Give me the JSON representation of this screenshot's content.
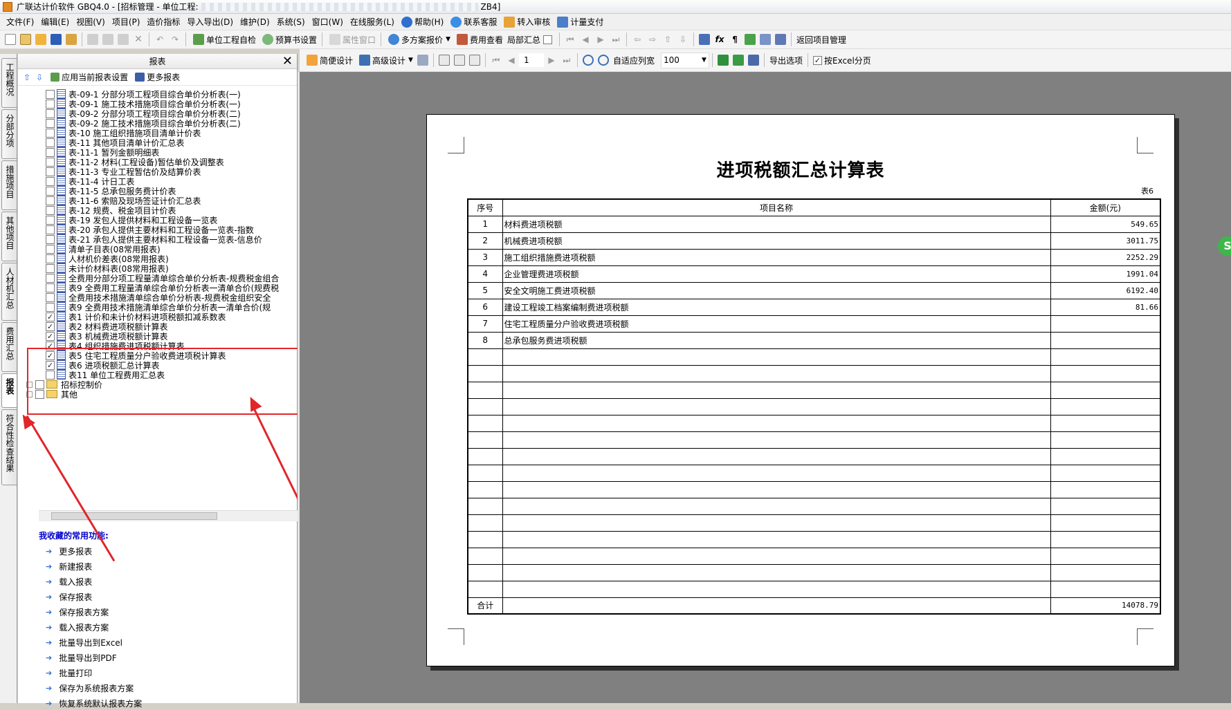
{
  "window": {
    "title_prefix": "广联达计价软件 GBQ4.0 - [招标管理 - 单位工程:",
    "title_suffix": "ZB4]"
  },
  "menu": [
    "文件(F)",
    "编辑(E)",
    "视图(V)",
    "项目(P)",
    "造价指标",
    "导入导出(D)",
    "维护(D)",
    "系统(S)",
    "窗口(W)",
    "在线服务(L)",
    "帮助(H)",
    "联系客服",
    "转入审核",
    "计量支付"
  ],
  "toolbar1": {
    "check": "单位工程自检",
    "budget": "预算书设置",
    "props": "属性窗口",
    "multi": "多方案报价",
    "fee": "费用查看",
    "local": "局部汇总",
    "back": "返回项目管理"
  },
  "toolbar2": {
    "simple": "简便设计",
    "advanced": "高级设计",
    "page": "1",
    "autofit": "自适应列宽",
    "zoom": "100",
    "export": "导出选项",
    "excel_page": "按Excel分页"
  },
  "vtabs": [
    "工程概况",
    "分部分项",
    "措施项目",
    "其他项目",
    "人材机汇总",
    "费用汇总",
    "报表",
    "符合性检查结果"
  ],
  "panel": {
    "title": "报表",
    "apply": "应用当前报表设置",
    "more": "更多报表"
  },
  "tree": [
    {
      "label": "表-09-1 分部分项工程项目综合单价分析表(一)",
      "checked": false
    },
    {
      "label": "表-09-1 施工技术措施项目综合单价分析表(一)",
      "checked": false
    },
    {
      "label": "表-09-2 分部分项工程项目综合单价分析表(二)",
      "checked": false
    },
    {
      "label": "表-09-2 施工技术措施项目综合单价分析表(二)",
      "checked": false
    },
    {
      "label": "表-10 施工组织措施项目清单计价表",
      "checked": false
    },
    {
      "label": "表-11 其他项目清单计价汇总表",
      "checked": false
    },
    {
      "label": "表-11-1 暂列金额明细表",
      "checked": false
    },
    {
      "label": "表-11-2 材料(工程设备)暂估单价及调整表",
      "checked": false
    },
    {
      "label": "表-11-3 专业工程暂估价及结算价表",
      "checked": false
    },
    {
      "label": "表-11-4 计日工表",
      "checked": false
    },
    {
      "label": "表-11-5 总承包服务费计价表",
      "checked": false
    },
    {
      "label": "表-11-6 索赔及现场签证计价汇总表",
      "checked": false
    },
    {
      "label": "表-12 规费、税金项目计价表",
      "checked": false
    },
    {
      "label": "表-19 发包人提供材料和工程设备一览表",
      "checked": false
    },
    {
      "label": "表-20 承包人提供主要材料和工程设备一览表-指数",
      "checked": false
    },
    {
      "label": "表-21 承包人提供主要材料和工程设备一览表-信息价",
      "checked": false
    },
    {
      "label": "清单子目表(08常用报表)",
      "checked": false
    },
    {
      "label": "人材机价差表(08常用报表)",
      "checked": false
    },
    {
      "label": "未计价材料表(08常用报表)",
      "checked": false
    },
    {
      "label": "全费用分部分项工程量清单综合单价分析表-规费税金组合",
      "checked": false
    },
    {
      "label": "表9 全费用工程量清单综合单价分析表一清单合价(规费税",
      "checked": false
    },
    {
      "label": "全费用技术措施清单综合单价分析表-规费税金组织安全",
      "checked": false
    },
    {
      "label": "表9 全费用技术措施清单综合单价分析表一清单合价(规",
      "checked": false
    },
    {
      "label": "表1 计价和未计价材料进项税额扣减系数表",
      "checked": true
    },
    {
      "label": "表2 材料费进项税额计算表",
      "checked": true
    },
    {
      "label": "表3 机械费进项税额计算表",
      "checked": true
    },
    {
      "label": "表4 组织措施费进项税额计算表",
      "checked": true
    },
    {
      "label": "表5 住宅工程质量分户验收费进项税计算表",
      "checked": true
    },
    {
      "label": "表6 进项税额汇总计算表",
      "checked": true
    },
    {
      "label": "表11 单位工程费用汇总表",
      "checked": false
    }
  ],
  "folders": [
    "招标控制价",
    "其他"
  ],
  "favorites": {
    "title": "我收藏的常用功能:",
    "items": [
      "更多报表",
      "新建报表",
      "载入报表",
      "保存报表",
      "保存报表方案",
      "载入报表方案",
      "批量导出到Excel",
      "批量导出到PDF",
      "批量打印",
      "保存为系统报表方案",
      "恢复系统默认报表方案"
    ]
  },
  "report": {
    "title": "进项税额汇总计算表",
    "number": "表6",
    "headers": [
      "序号",
      "项目名称",
      "金额(元)"
    ],
    "rows": [
      [
        "1",
        "材料费进项税额",
        "549.65"
      ],
      [
        "2",
        "机械费进项税额",
        "3011.75"
      ],
      [
        "3",
        "施工组织措施费进项税额",
        "2252.29"
      ],
      [
        "4",
        "企业管理费进项税额",
        "1991.04"
      ],
      [
        "5",
        "安全文明施工费进项税额",
        "6192.40"
      ],
      [
        "6",
        "建设工程竣工档案编制费进项税额",
        "81.66"
      ],
      [
        "7",
        "住宅工程质量分户验收费进项税额",
        ""
      ],
      [
        "8",
        "总承包服务费进项税额",
        ""
      ]
    ],
    "blank_rows": 15,
    "total_label": "合计",
    "total_value": "14078.79"
  },
  "side_badge": "S",
  "colors": {
    "highlight": "#e0262b",
    "link": "#0000cc",
    "canvas": "#808080"
  }
}
